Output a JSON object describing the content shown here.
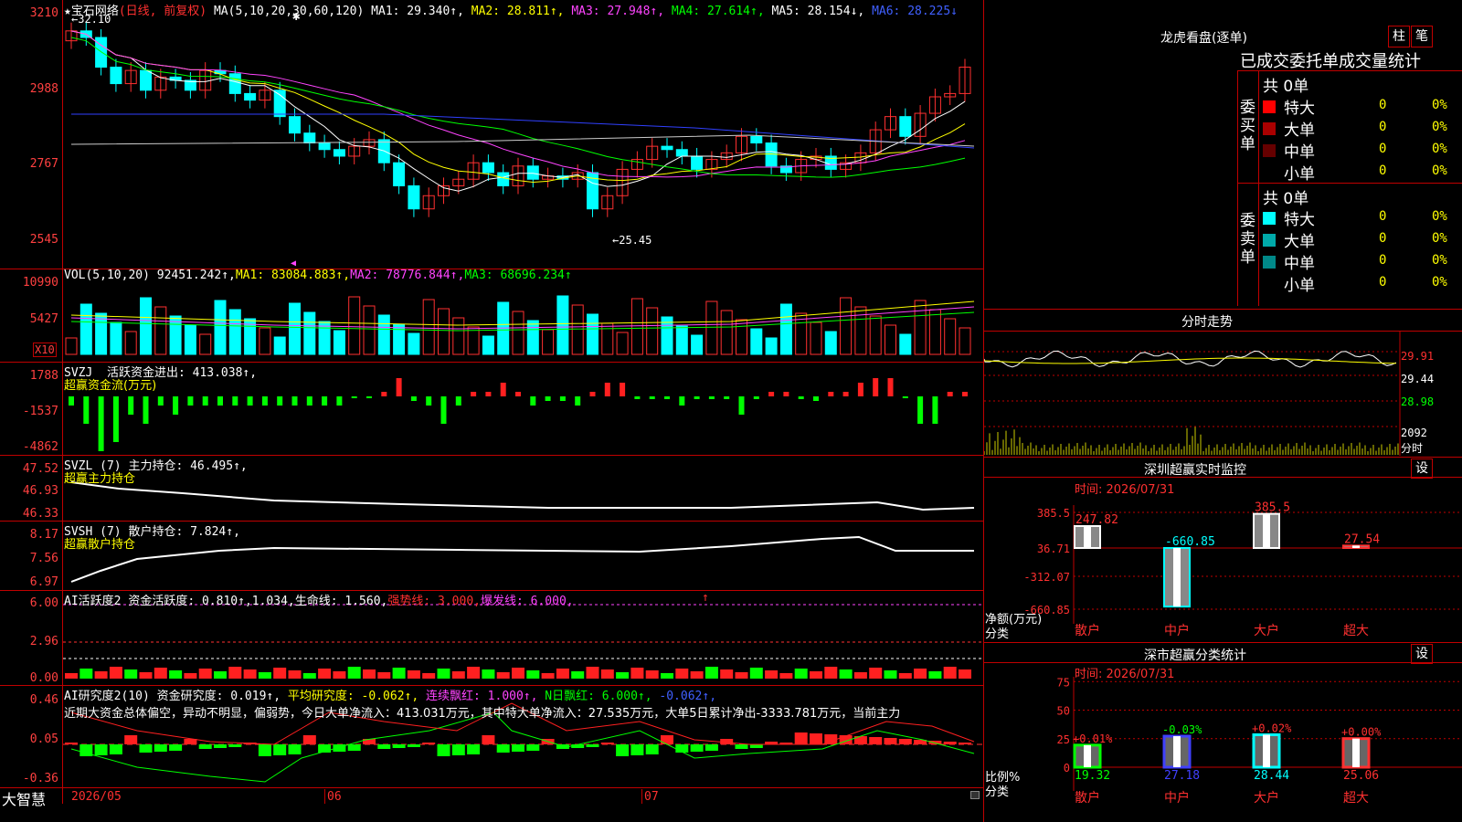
{
  "stock": {
    "title": "★宝石网络",
    "adj": "(日线, 前复权)"
  },
  "ma_line": {
    "prefix": "MA(5,10,20,30,60,120)",
    "ma1": "MA1: 29.340↑,",
    "ma2": "MA2: 28.811↑,",
    "ma3": "MA3: 27.948↑,",
    "ma4": "MA4: 27.614↑,",
    "ma5": "MA5: 28.154↓,",
    "ma6": "MA6: 28.225↓"
  },
  "price_axis": [
    "3210",
    "2988",
    "2767",
    "2545"
  ],
  "price_marks": {
    "high": "←32.10",
    "low": "←25.45"
  },
  "vol": {
    "label": "VOL(5,10,20)",
    "value": "92451.242↑,",
    "ma1": "MA1: 83084.883↑,",
    "ma2": "MA2: 78776.844↑,",
    "ma3": "MA3: 68696.234↑",
    "axis": [
      "10990",
      "5427"
    ],
    "unit": "X10"
  },
  "svzj": {
    "label": "SVZJ",
    "title": "活跃资金进出: 413.038↑,",
    "sub": "超赢资金流(万元)",
    "axis": [
      "1788",
      "-1537",
      "-4862"
    ]
  },
  "svzl": {
    "label": "SVZL (7)",
    "title": "主力持仓: 46.495↑,",
    "sub": "超赢主力持仓",
    "axis": [
      "47.52",
      "46.93",
      "46.33"
    ]
  },
  "svsh": {
    "label": "SVSH (7)",
    "title": "散户持仓: 7.824↑,",
    "sub": "超赢散户持仓",
    "axis": [
      "8.17",
      "7.56",
      "6.97"
    ]
  },
  "ai2": {
    "label": "AI活跃度2",
    "t1": "资金活跃度: 0.810↑,",
    "t2": "1.034,",
    "t3": "生命线: 1.560,",
    "t4": "强势线: 3.000,",
    "t5": "爆发线: 6.000,",
    "arrow": "↑",
    "axis": [
      "6.00",
      "2.96",
      "0.00"
    ]
  },
  "ai_research": {
    "label": "AI研究度2(10)",
    "t1": "资金研究度: 0.019↑,",
    "t2": "平均研究度: -0.062↑,",
    "t3": "连续飘红: 1.000↑,",
    "t4": "N日飘红: 6.000↑,",
    "t5": "-0.062↑,",
    "desc": "近期大资金总体偏空，异动不明显，偏弱势，今日大单净流入：413.031万元，其中特大单净流入：27.535万元，大单5日累计净出-3333.781万元，当前主力",
    "axis": [
      "0.46",
      "0.05",
      "-0.36"
    ]
  },
  "bottom_bar": {
    "brand": "大智慧",
    "dates": [
      "2026/05",
      "06",
      "07"
    ]
  },
  "dragon": {
    "title": "龙虎看盘(逐单)",
    "btn_bar": "柱",
    "btn_pen": "笔",
    "tabs": "已成交委托单成交量统计",
    "buy_label": "委买单",
    "sell_label": "委卖单",
    "buy_total": "共 0单",
    "sell_total": "共 0单",
    "buy_rows": [
      {
        "name": "特大",
        "count": "0",
        "pct": "0%",
        "color": "#ff0000"
      },
      {
        "name": "大单",
        "count": "0",
        "pct": "0%",
        "color": "#aa0000"
      },
      {
        "name": "中单",
        "count": "0",
        "pct": "0%",
        "color": "#660000"
      },
      {
        "name": "小单",
        "count": "0",
        "pct": "0%",
        "color": "#000000"
      }
    ],
    "sell_rows": [
      {
        "name": "特大",
        "count": "0",
        "pct": "0%",
        "color": "#00ffff"
      },
      {
        "name": "大单",
        "count": "0",
        "pct": "0%",
        "color": "#00aaaa"
      },
      {
        "name": "中单",
        "count": "0",
        "pct": "0%",
        "color": "#008888"
      },
      {
        "name": "小单",
        "count": "0",
        "pct": "0%",
        "color": "#000000"
      }
    ]
  },
  "intraday": {
    "title": "分时走势",
    "axis": [
      "29.91",
      "29.44",
      "28.98"
    ],
    "vol_axis": "2092",
    "vol_unit": "分时"
  },
  "sz_monitor": {
    "title": "深圳超赢实时监控",
    "btn": "设",
    "time": "时间: 2026/07/31",
    "axis": [
      "385.5",
      "36.71",
      "-312.07",
      "-660.85"
    ],
    "unit": "净额(万元)",
    "cat_label": "分类",
    "categories": [
      "散户",
      "中户",
      "大户",
      "超大"
    ],
    "values": [
      247.82,
      -660.85,
      385.5,
      27.54
    ],
    "value_labels": [
      "247.82",
      "-660.85",
      "385.5",
      "27.54"
    ]
  },
  "sz_stats": {
    "title": "深市超赢分类统计",
    "btn": "设",
    "time": "时间: 2026/07/31",
    "axis": [
      "75",
      "50",
      "25",
      "0"
    ],
    "unit": "比例%",
    "cat_label": "分类",
    "categories": [
      "散户",
      "中户",
      "大户",
      "超大"
    ],
    "values": [
      19.32,
      27.18,
      28.44,
      25.06
    ],
    "changes": [
      "+0.01%",
      "-0.03%",
      "+0.02%",
      "+0.00%"
    ],
    "colors": [
      "#00ff00",
      "#4040ff",
      "#00ffff",
      "#ff3030"
    ]
  }
}
